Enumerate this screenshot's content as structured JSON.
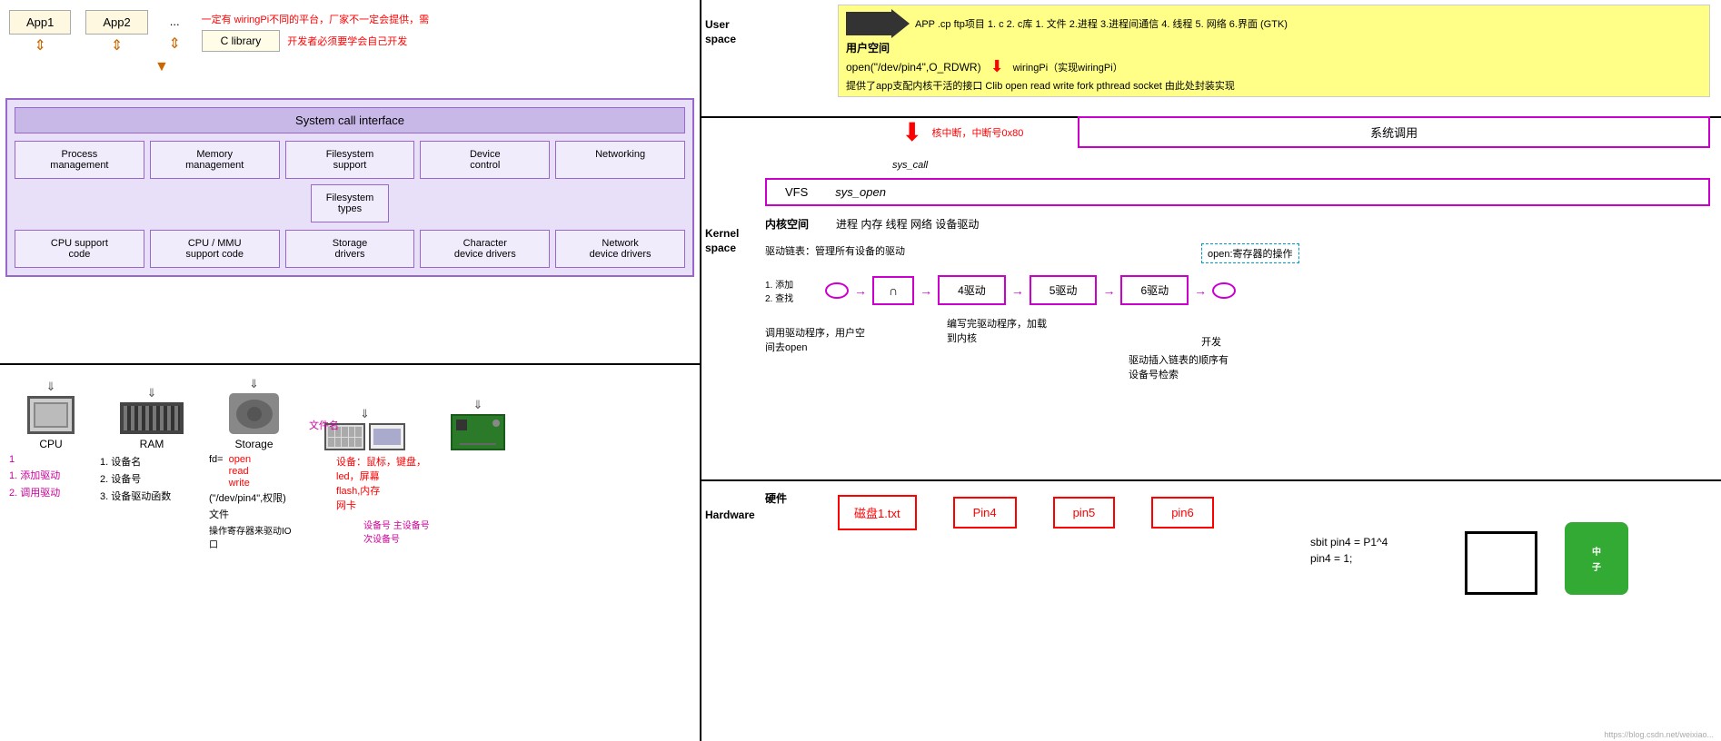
{
  "left": {
    "apps": [
      "App1",
      "App2",
      "..."
    ],
    "warning": "一定有   wiringPi不同的平台，厂家不一定会提供，需",
    "clibrary": "C library",
    "devmust": "开发者必须要学会自己开发",
    "syscall_interface": "System call interface",
    "kernel_cells": [
      {
        "label": "Process\nmanagement"
      },
      {
        "label": "Memory\nmanagement"
      },
      {
        "label": "Filesystem\nsupport"
      },
      {
        "label": "Device\ncontrol"
      },
      {
        "label": "Networking"
      }
    ],
    "fs_types": "Filesystem\ntypes",
    "driver_cells": [
      {
        "label": "CPU support\ncode"
      },
      {
        "label": "CPU / MMU\nsupport code"
      },
      {
        "label": "Storage\ndrivers"
      },
      {
        "label": "Character\ndevice drivers"
      },
      {
        "label": "Network\ndevice drivers"
      }
    ],
    "hw_items": [
      "CPU",
      "RAM",
      "Storage"
    ],
    "notes": {
      "left_col": [
        "1",
        "1. 添加驱动",
        "2. 调用驱动"
      ],
      "mid_col": [
        "1. 设备名",
        "2. 设备号",
        "3. 设备驱动函数"
      ],
      "fd_col": [
        "fd=",
        "open",
        "read",
        "write"
      ],
      "path_text": "(\"/dev/pin4\",权限)",
      "file_text": "文件",
      "dev_text": "设备：鼠标，键盘，\nled，屏幕\nflash,内存\n网卡",
      "io_text": "操作寄存器来驱动IO\n口"
    }
  },
  "right": {
    "user_space_label": "User\nspace",
    "kernel_space_label": "Kernel\nspace",
    "hardware_label": "Hardware",
    "yonghu_label": "用户空间",
    "neikong_label": "内核空间",
    "yingji_label": "硬件",
    "app_line": "APP .cp ftp项目    1. c  2. c库    1. 文件 2.进程 3.进程间通信 4. 线程 5. 网络   6.界面  (GTK)",
    "open_line": "open(\"/dev/pin4\",O_RDWR)",
    "wiringpi_line": "wiringPi（实现wiringPi）",
    "clib_line": "提供了app支配内核干活的接口  Clib  open read write fork pthread socket 由此处封装实现",
    "zhongduan": "核中断，中断号0x80",
    "xitiao": "系统调用",
    "syscall_call": "sys_call",
    "vfs_label": "VFS",
    "sys_open": "sys_open",
    "neikong_items": "进程 内存 线程 网络    设备驱动",
    "drive_table": "驱动链表：管理所有设备的驱动",
    "open_register": "open:寄存器的操作",
    "add_items": "1. 添加\n2. 查找",
    "drive_chain": [
      "∩",
      "4驱动",
      "5驱动",
      "6驱动"
    ],
    "hw_boxes": [
      "磁盘1.txt",
      "Pin4",
      "pin5",
      "pin6"
    ],
    "call_driver": "调用驱动程序，用户空\n间去open",
    "write_load": "编写完驱动程序，加载\n到内核",
    "develop": "开发",
    "chain_order": "驱动插入链表的顺序有\n设备号检索",
    "sbit": "sbit pin4 = P1^4",
    "pin4": "pin4 = 1;",
    "filename_label": "文件名",
    "device_major": "设备号 主设备号",
    "device_minor": "次设备号",
    "url": "https://blog.csdn.net/weixiao..."
  }
}
